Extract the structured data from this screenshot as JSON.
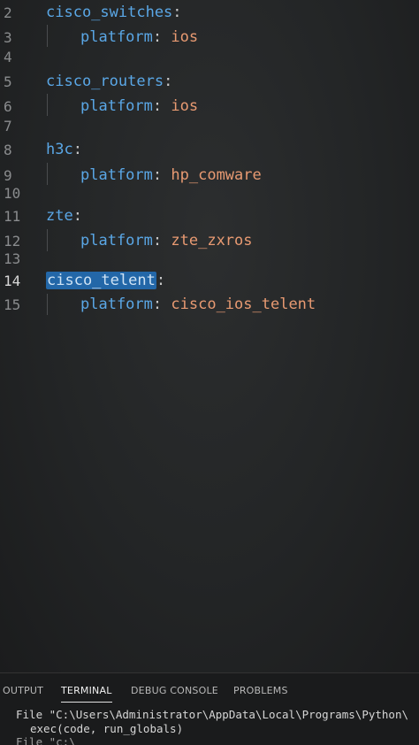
{
  "editor": {
    "lines": [
      {
        "num": "2",
        "key": "cisco_switches",
        "colon": ":",
        "indent": false
      },
      {
        "num": "3",
        "key": "platform",
        "colon": ":",
        "value": "ios",
        "indent": true
      },
      {
        "num": "4"
      },
      {
        "num": "5",
        "key": "cisco_routers",
        "colon": ":",
        "indent": false
      },
      {
        "num": "6",
        "key": "platform",
        "colon": ":",
        "value": "ios",
        "indent": true
      },
      {
        "num": "7"
      },
      {
        "num": "8",
        "key": "h3c",
        "colon": ":",
        "indent": false
      },
      {
        "num": "9",
        "key": "platform",
        "colon": ":",
        "value": "hp_comware",
        "indent": true
      },
      {
        "num": "10"
      },
      {
        "num": "11",
        "key": "zte",
        "colon": ":",
        "indent": false
      },
      {
        "num": "12",
        "key": "platform",
        "colon": ":",
        "value": "zte_zxros",
        "indent": true
      },
      {
        "num": "13"
      },
      {
        "num": "14",
        "key": "cisco_telent",
        "colon": ":",
        "indent": false,
        "selected": true
      },
      {
        "num": "15",
        "key": "platform",
        "colon": ":",
        "value": "cisco_ios_telent",
        "indent": true
      }
    ]
  },
  "panel": {
    "tabs": [
      "OUTPUT",
      "TERMINAL",
      "DEBUG CONSOLE",
      "PROBLEMS"
    ],
    "active_tab": "TERMINAL",
    "terminal_lines": [
      "File \"C:\\Users\\Administrator\\AppData\\Local\\Programs\\Python\\",
      "exec(code, run_globals)",
      "File \"c:\\"
    ]
  },
  "colors": {
    "key": "#5aa7e6",
    "value": "#e89a72",
    "selection": "#2367a8"
  }
}
